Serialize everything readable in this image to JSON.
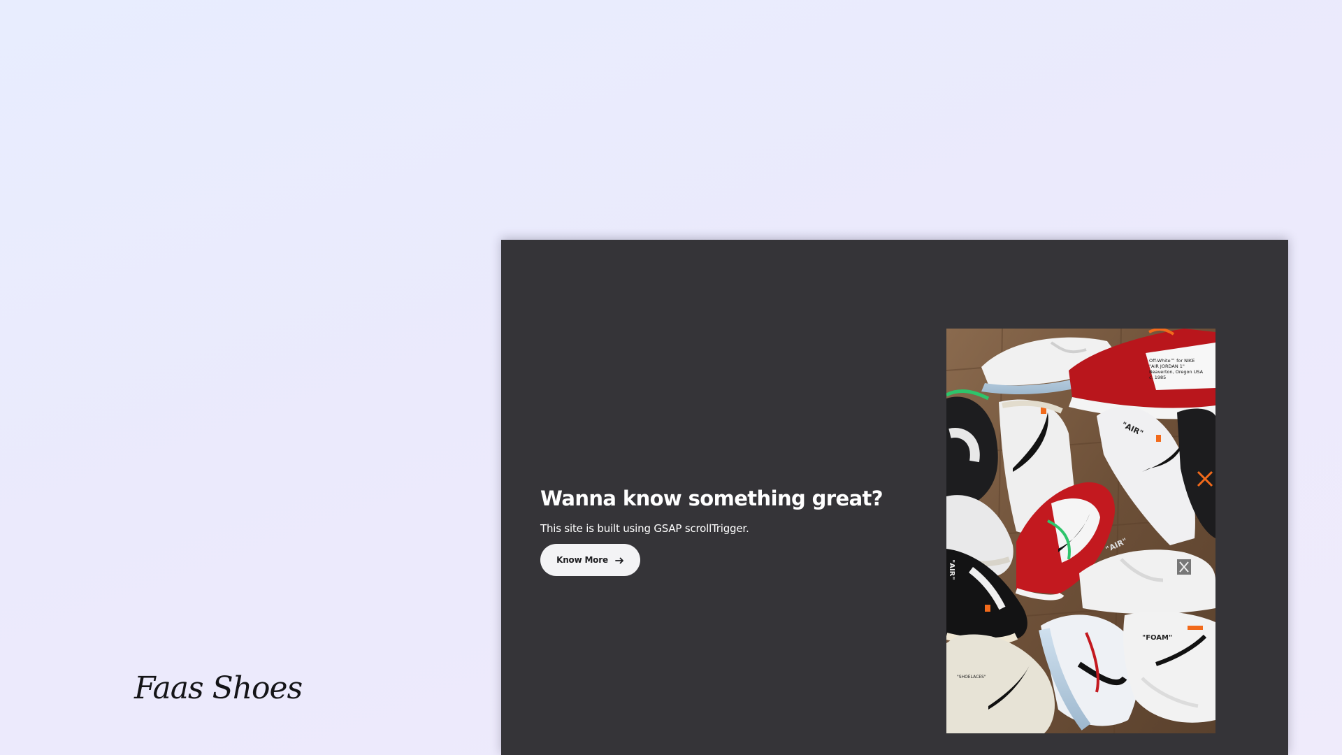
{
  "brand": {
    "name": "Faas Shoes"
  },
  "hero": {
    "headline": "Wanna know something great?",
    "subtext": "This site is built using GSAP scrollTrigger.",
    "cta_label": "Know More",
    "cta_icon": "arrow-right-icon"
  },
  "photo": {
    "sub": "sneakers-collection",
    "tongue_text_lines": [
      "Off-White™ for NIKE",
      "\"AIR JORDAN 1\"",
      "Beaverton, Oregon USA",
      "c. 1985"
    ],
    "air_label": "\"AIR\"",
    "foam_label": "\"FOAM\"",
    "shoelaces_label": "\"SHOELACES\""
  },
  "colors": {
    "page_bg_start": "#e8edfe",
    "page_bg_end": "#efebfb",
    "panel_bg": "#353438",
    "button_bg": "#f3f3f5",
    "accent_red": "#b9161c",
    "accent_orange": "#f26a1b"
  }
}
